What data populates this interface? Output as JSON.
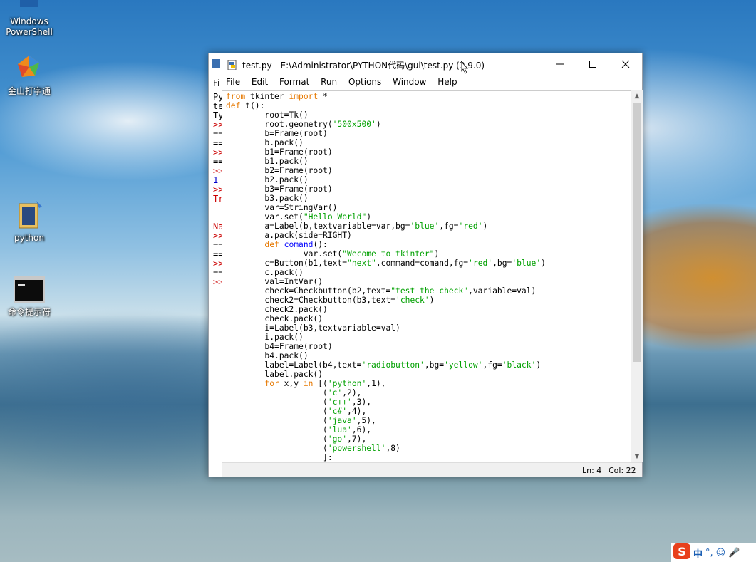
{
  "desktop": {
    "icons": [
      {
        "label": "Windows PowerShell"
      },
      {
        "label": "金山打字通"
      },
      {
        "label": "python"
      },
      {
        "label": "命令提示符"
      }
    ]
  },
  "shell_window": {
    "lines": [
      "Py",
      "te",
      "Ty",
      ">>",
      "==",
      "==",
      ">>",
      "==",
      ">>",
      "1",
      ">>",
      "Tr",
      "",
      "",
      "Na",
      ">>",
      "==",
      "==",
      ">>",
      "==",
      ">>"
    ],
    "line_colors": [
      "#000000",
      "#000000",
      "#000000",
      "#cc0000",
      "#000000",
      "#000000",
      "#cc0000",
      "#000000",
      "#cc0000",
      "#0000cc",
      "#cc0000",
      "#cc0000",
      "#000000",
      "#000000",
      "#cc0000",
      "#cc0000",
      "#000000",
      "#000000",
      "#cc0000",
      "#000000",
      "#cc0000"
    ]
  },
  "editor": {
    "title": "test.py - E:\\Administrator\\PYTHON代码\\gui\\test.py (3.9.0)",
    "menu": [
      "File",
      "Edit",
      "Format",
      "Run",
      "Options",
      "Window",
      "Help"
    ],
    "status": {
      "line": "Ln: 4",
      "col": "Col: 22"
    },
    "colors": {
      "keyword": "#e67800",
      "string": "#00a000",
      "definition": "#0000ff"
    },
    "code_lines": [
      [
        [
          "kw",
          "from"
        ],
        [
          "t",
          " tkinter "
        ],
        [
          "kw",
          "import"
        ],
        [
          "t",
          " *"
        ]
      ],
      [
        [
          "kw",
          "def"
        ],
        [
          "t",
          " t():"
        ]
      ],
      [
        [
          "t",
          "        root=Tk()"
        ]
      ],
      [
        [
          "t",
          "        root.geometry("
        ],
        [
          "str",
          "'500x500'"
        ],
        [
          "t",
          ")"
        ]
      ],
      [
        [
          "t",
          "        b=Frame(root)"
        ]
      ],
      [
        [
          "t",
          "        b.pack()"
        ]
      ],
      [
        [
          "t",
          "        b1=Frame(root)"
        ]
      ],
      [
        [
          "t",
          "        b1.pack()"
        ]
      ],
      [
        [
          "t",
          "        b2=Frame(root)"
        ]
      ],
      [
        [
          "t",
          "        b2.pack()"
        ]
      ],
      [
        [
          "t",
          "        b3=Frame(root)"
        ]
      ],
      [
        [
          "t",
          "        b3.pack()"
        ]
      ],
      [
        [
          "t",
          "        var=StringVar()"
        ]
      ],
      [
        [
          "t",
          "        var.set("
        ],
        [
          "str",
          "\"Hello World\""
        ],
        [
          "t",
          ")"
        ]
      ],
      [
        [
          "t",
          "        a=Label(b,textvariable=var,bg="
        ],
        [
          "str",
          "'blue'"
        ],
        [
          "t",
          ",fg="
        ],
        [
          "str",
          "'red'"
        ],
        [
          "t",
          ")"
        ]
      ],
      [
        [
          "t",
          "        a.pack(side=RIGHT)"
        ]
      ],
      [
        [
          "t",
          "        "
        ],
        [
          "kw",
          "def"
        ],
        [
          "t",
          " "
        ],
        [
          "fn",
          "comand"
        ],
        [
          "t",
          "():"
        ]
      ],
      [
        [
          "t",
          "                var.set("
        ],
        [
          "str",
          "\"Wecome to tkinter\""
        ],
        [
          "t",
          ")"
        ]
      ],
      [
        [
          "t",
          "        c=Button(b1,text="
        ],
        [
          "str",
          "\"next\""
        ],
        [
          "t",
          ",command=comand,fg="
        ],
        [
          "str",
          "'red'"
        ],
        [
          "t",
          ",bg="
        ],
        [
          "str",
          "'blue'"
        ],
        [
          "t",
          ")"
        ]
      ],
      [
        [
          "t",
          "        c.pack()"
        ]
      ],
      [
        [
          "t",
          "        val=IntVar()"
        ]
      ],
      [
        [
          "t",
          "        check=Checkbutton(b2,text="
        ],
        [
          "str",
          "\"test the check\""
        ],
        [
          "t",
          ",variable=val)"
        ]
      ],
      [
        [
          "t",
          "        check2=Checkbutton(b3,text="
        ],
        [
          "str",
          "'check'"
        ],
        [
          "t",
          ")"
        ]
      ],
      [
        [
          "t",
          "        check2.pack()"
        ]
      ],
      [
        [
          "t",
          "        check.pack()"
        ]
      ],
      [
        [
          "t",
          "        i=Label(b3,textvariable=val)"
        ]
      ],
      [
        [
          "t",
          "        i.pack()"
        ]
      ],
      [
        [
          "t",
          "        b4=Frame(root)"
        ]
      ],
      [
        [
          "t",
          "        b4.pack()"
        ]
      ],
      [
        [
          "t",
          "        label=Label(b4,text="
        ],
        [
          "str",
          "'radiobutton'"
        ],
        [
          "t",
          ",bg="
        ],
        [
          "str",
          "'yellow'"
        ],
        [
          "t",
          ",fg="
        ],
        [
          "str",
          "'black'"
        ],
        [
          "t",
          ")"
        ]
      ],
      [
        [
          "t",
          "        label.pack()"
        ]
      ],
      [
        [
          "t",
          "        "
        ],
        [
          "kw",
          "for"
        ],
        [
          "t",
          " x,y "
        ],
        [
          "kw",
          "in"
        ],
        [
          "t",
          " [("
        ],
        [
          "str",
          "'python'"
        ],
        [
          "t",
          ",1),"
        ]
      ],
      [
        [
          "t",
          "                    ("
        ],
        [
          "str",
          "'c'"
        ],
        [
          "t",
          ",2),"
        ]
      ],
      [
        [
          "t",
          "                    ("
        ],
        [
          "str",
          "'c++'"
        ],
        [
          "t",
          ",3),"
        ]
      ],
      [
        [
          "t",
          "                    ("
        ],
        [
          "str",
          "'c#'"
        ],
        [
          "t",
          ",4),"
        ]
      ],
      [
        [
          "t",
          "                    ("
        ],
        [
          "str",
          "'java'"
        ],
        [
          "t",
          ",5),"
        ]
      ],
      [
        [
          "t",
          "                    ("
        ],
        [
          "str",
          "'lua'"
        ],
        [
          "t",
          ",6),"
        ]
      ],
      [
        [
          "t",
          "                    ("
        ],
        [
          "str",
          "'go'"
        ],
        [
          "t",
          ",7),"
        ]
      ],
      [
        [
          "t",
          "                    ("
        ],
        [
          "str",
          "'powershell'"
        ],
        [
          "t",
          ",8)"
        ]
      ],
      [
        [
          "t",
          "                    ]:"
        ]
      ]
    ]
  },
  "taskbar_tray": {
    "ime_label": "中",
    "punct": "°,"
  }
}
